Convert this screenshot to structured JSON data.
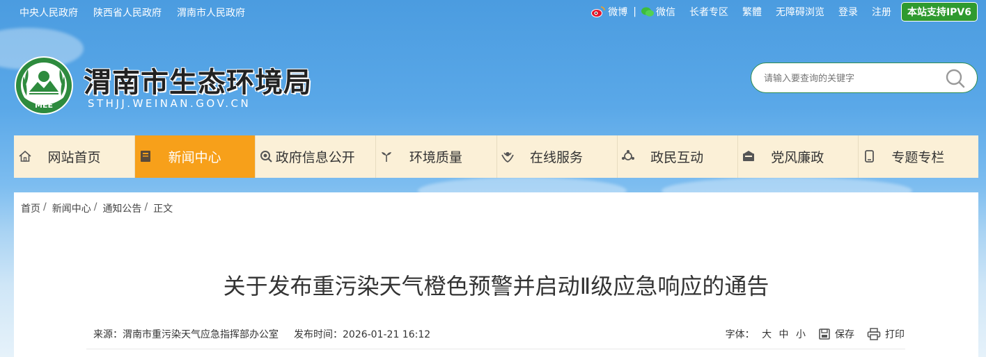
{
  "topbar": {
    "left_links": [
      "中央人民政府",
      "陕西省人民政府",
      "渭南市人民政府"
    ],
    "weibo": "微博",
    "wechat": "微信",
    "right_links": [
      "长者专区",
      "繁體",
      "无障碍浏览",
      "登录",
      "注册"
    ],
    "ipv6": "本站支持IPV6"
  },
  "header": {
    "logo_text": "MEE",
    "title": "渭南市生态环境局",
    "domain": "STHJJ.WEINAN.GOV.CN"
  },
  "search": {
    "placeholder": "请输入要查询的关键字",
    "icon": "search-icon"
  },
  "nav": {
    "items": [
      {
        "label": "网站首页",
        "icon": "home-icon"
      },
      {
        "label": "新闻中心",
        "icon": "book-icon"
      },
      {
        "label": "政府信息公开",
        "icon": "magnifier-icon"
      },
      {
        "label": "环境质量",
        "icon": "plant-icon"
      },
      {
        "label": "在线服务",
        "icon": "service-icon"
      },
      {
        "label": "政民互动",
        "icon": "interaction-icon"
      },
      {
        "label": "党风廉政",
        "icon": "mailbox-icon"
      },
      {
        "label": "专题专栏",
        "icon": "phone-icon"
      }
    ],
    "active_index": 1,
    "active_color": "#f7a01a"
  },
  "breadcrumb": [
    "首页",
    "新闻中心",
    "通知公告",
    "正文"
  ],
  "article": {
    "title": "关于发布重污染天气橙色预警并启动Ⅱ级应急响应的通告",
    "source": "来源：渭南市重污染天气应急指挥部办公室",
    "publish_time": "发布时间：2026-01-21 16:12",
    "font_label": "字体：",
    "font_sizes": [
      "大",
      "中",
      "小"
    ],
    "save": "保存",
    "print": "打印"
  },
  "colors": {
    "ipv6_green": "#2f9a2f",
    "nav_bg": "#fbf0d7",
    "search_border": "#2f8c4e"
  }
}
